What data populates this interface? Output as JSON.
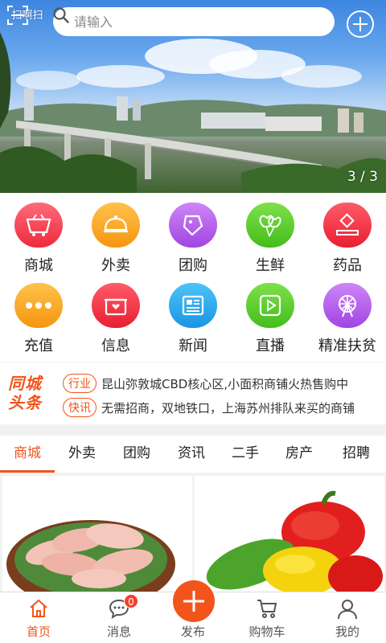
{
  "header": {
    "scan_label": "扫啊扫",
    "search_placeholder": "请输入",
    "banner_indicator": "3 / 3"
  },
  "categories": [
    {
      "label": "商城",
      "icon": "shopping-basket-icon",
      "color": "#f23a4d"
    },
    {
      "label": "外卖",
      "icon": "food-cloche-icon",
      "color": "#f7a11a"
    },
    {
      "label": "团购",
      "icon": "tag-icon",
      "color": "#b25ae8"
    },
    {
      "label": "生鲜",
      "icon": "heart-balloon-icon",
      "color": "#56cb2c"
    },
    {
      "label": "药品",
      "icon": "medicine-box-icon",
      "color": "#f0323e"
    },
    {
      "label": "充值",
      "icon": "more-dots-icon",
      "color": "#f7a11a"
    },
    {
      "label": "信息",
      "icon": "message-box-icon",
      "color": "#f0323e"
    },
    {
      "label": "新闻",
      "icon": "newspaper-icon",
      "color": "#2aa8ec"
    },
    {
      "label": "直播",
      "icon": "play-icon",
      "color": "#56cb2c"
    },
    {
      "label": "精准扶贫",
      "icon": "ferris-wheel-icon",
      "color": "#b25ae8"
    }
  ],
  "headlines": {
    "logo_line1": "同城",
    "logo_line2": "头条",
    "items": [
      {
        "tag": "行业",
        "text": "昆山弥敦城CBD核心区,小面积商铺火热售购中"
      },
      {
        "tag": "快讯",
        "text": "无需招商，双地铁口，上海苏州排队来买的商铺"
      }
    ]
  },
  "tabs": [
    "商城",
    "外卖",
    "团购",
    "资讯",
    "二手",
    "房产",
    "招聘"
  ],
  "active_tab": "商城",
  "bottom_nav": {
    "items": [
      {
        "label": "首页",
        "icon": "home-icon"
      },
      {
        "label": "消息",
        "icon": "chat-icon",
        "badge": "0"
      },
      {
        "label": "发布",
        "icon": "plus-icon"
      },
      {
        "label": "购物车",
        "icon": "cart-icon"
      },
      {
        "label": "我的",
        "icon": "user-icon"
      }
    ],
    "active": "首页"
  },
  "colors": {
    "accent": "#f2541c",
    "badge": "#f2412b"
  }
}
